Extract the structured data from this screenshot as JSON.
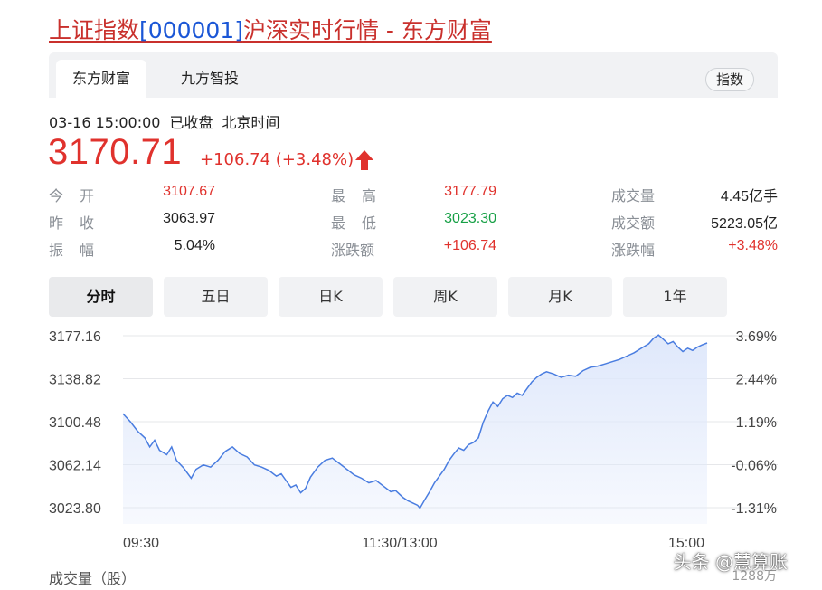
{
  "page": {
    "title_name": "上证指数",
    "title_code": "[000001]",
    "title_rest": "沪深实时行情 - 东方财富"
  },
  "source_tabs": [
    "东方财富",
    "九方智投"
  ],
  "index_button": "指数",
  "status": {
    "time": "03-16 15:00:00",
    "state": "已收盘",
    "zone": "北京时间"
  },
  "quote": {
    "price": "3170.71",
    "change": "+106.74 (+3.48%)"
  },
  "stats": [
    {
      "label": "今开",
      "value": "3107.67",
      "color": "red"
    },
    {
      "label": "昨收",
      "value": "3063.97",
      "color": "dark"
    },
    {
      "label": "振幅",
      "value": "5.04%",
      "color": "dark"
    },
    {
      "label": "最高",
      "value": "3177.79",
      "color": "red"
    },
    {
      "label": "最低",
      "value": "3023.30",
      "color": "green"
    },
    {
      "label": "涨跌额",
      "value": "+106.74",
      "color": "red"
    },
    {
      "label": "成交量",
      "value": "4.45亿手",
      "color": "dark"
    },
    {
      "label": "成交额",
      "value": "5223.05亿",
      "color": "dark"
    },
    {
      "label": "涨跌幅",
      "value": "+3.48%",
      "color": "red"
    }
  ],
  "period_tabs": [
    "分时",
    "五日",
    "日K",
    "周K",
    "月K",
    "1年"
  ],
  "active_period": "分时",
  "chart_data": {
    "type": "area",
    "y_ticks": [
      "3177.16",
      "3138.82",
      "3100.48",
      "3062.14",
      "3023.80"
    ],
    "y_ticks_right": [
      "3.69%",
      "2.44%",
      "1.19%",
      "-0.06%",
      "-1.31%"
    ],
    "x_ticks": [
      "09:30",
      "11:30/13:00",
      "15:00"
    ],
    "ylim": [
      3023.8,
      3177.16
    ],
    "x_count": 241,
    "line_color": "#4a7de0",
    "fill_color": "#dfe8fb",
    "points": [
      [
        0,
        3107.7
      ],
      [
        3,
        3100.5
      ],
      [
        6,
        3092.0
      ],
      [
        9,
        3086.0
      ],
      [
        11,
        3078.0
      ],
      [
        13,
        3084.0
      ],
      [
        15,
        3075.0
      ],
      [
        18,
        3071.0
      ],
      [
        20,
        3078.0
      ],
      [
        22,
        3066.0
      ],
      [
        25,
        3059.0
      ],
      [
        28,
        3050.0
      ],
      [
        30,
        3058.0
      ],
      [
        33,
        3062.0
      ],
      [
        36,
        3060.0
      ],
      [
        39,
        3066.0
      ],
      [
        42,
        3074.0
      ],
      [
        45,
        3078.0
      ],
      [
        48,
        3072.0
      ],
      [
        51,
        3069.0
      ],
      [
        54,
        3062.0
      ],
      [
        57,
        3060.0
      ],
      [
        60,
        3057.0
      ],
      [
        63,
        3052.0
      ],
      [
        65,
        3054.0
      ],
      [
        67,
        3048.0
      ],
      [
        69,
        3042.0
      ],
      [
        71,
        3044.0
      ],
      [
        73,
        3037.0
      ],
      [
        75,
        3041.0
      ],
      [
        77,
        3051.0
      ],
      [
        80,
        3060.0
      ],
      [
        83,
        3066.0
      ],
      [
        86,
        3068.0
      ],
      [
        89,
        3063.0
      ],
      [
        92,
        3058.0
      ],
      [
        95,
        3053.0
      ],
      [
        98,
        3050.0
      ],
      [
        101,
        3046.0
      ],
      [
        104,
        3048.0
      ],
      [
        107,
        3043.0
      ],
      [
        110,
        3038.0
      ],
      [
        112,
        3039.0
      ],
      [
        115,
        3033.0
      ],
      [
        117,
        3030.0
      ],
      [
        119,
        3028.0
      ],
      [
        121,
        3026.0
      ],
      [
        122,
        3023.3
      ],
      [
        124,
        3031.0
      ],
      [
        126,
        3038.0
      ],
      [
        128,
        3046.0
      ],
      [
        130,
        3052.0
      ],
      [
        132,
        3058.0
      ],
      [
        134,
        3066.0
      ],
      [
        136,
        3072.0
      ],
      [
        138,
        3077.0
      ],
      [
        140,
        3075.0
      ],
      [
        142,
        3080.0
      ],
      [
        144,
        3082.0
      ],
      [
        146,
        3086.0
      ],
      [
        148,
        3100.0
      ],
      [
        150,
        3110.0
      ],
      [
        152,
        3118.0
      ],
      [
        154,
        3114.0
      ],
      [
        156,
        3121.0
      ],
      [
        158,
        3124.0
      ],
      [
        160,
        3122.0
      ],
      [
        162,
        3126.0
      ],
      [
        164,
        3124.0
      ],
      [
        166,
        3130.0
      ],
      [
        168,
        3136.0
      ],
      [
        170,
        3140.0
      ],
      [
        172,
        3143.0
      ],
      [
        174,
        3145.0
      ],
      [
        177,
        3143.0
      ],
      [
        180,
        3140.0
      ],
      [
        183,
        3142.0
      ],
      [
        186,
        3141.0
      ],
      [
        189,
        3146.0
      ],
      [
        192,
        3149.0
      ],
      [
        195,
        3150.0
      ],
      [
        198,
        3152.0
      ],
      [
        201,
        3154.0
      ],
      [
        204,
        3156.0
      ],
      [
        207,
        3159.0
      ],
      [
        210,
        3162.0
      ],
      [
        213,
        3166.0
      ],
      [
        216,
        3170.0
      ],
      [
        218,
        3175.0
      ],
      [
        220,
        3177.8
      ],
      [
        222,
        3174.0
      ],
      [
        224,
        3170.0
      ],
      [
        226,
        3172.0
      ],
      [
        228,
        3167.0
      ],
      [
        230,
        3163.0
      ],
      [
        232,
        3166.0
      ],
      [
        234,
        3164.0
      ],
      [
        236,
        3167.0
      ],
      [
        238,
        3169.0
      ],
      [
        240,
        3170.7
      ]
    ]
  },
  "volume_label": "成交量（股）",
  "volume_right": "1288万",
  "watermark": "头条 @慧算账"
}
